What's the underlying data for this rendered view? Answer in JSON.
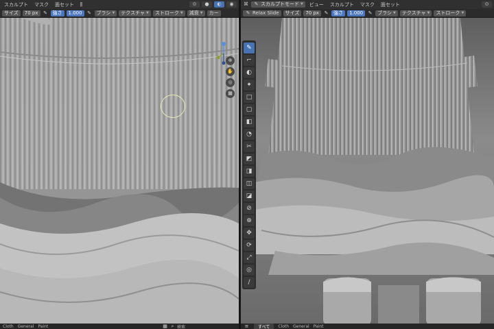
{
  "left": {
    "header_top": {
      "items": [
        "スカルプト",
        "マスク",
        "面セット"
      ],
      "mode_icons": [
        "ǁ",
        "範囲"
      ]
    },
    "header_tool": {
      "size_label": "サイズ",
      "size_value": "70 px",
      "strength_label": "強さ",
      "strength_value": "1.000",
      "brush_label": "ブラシ",
      "texture_label": "テクスチャ",
      "stroke_label": "ストローク",
      "falloff_label": "減衰",
      "cursor_label": "カー"
    },
    "footer_tabs": [
      "Cloth",
      "General",
      "Paint"
    ]
  },
  "right": {
    "header_top": {
      "mode": "スカルプトモード",
      "items": [
        "ビュー",
        "スカルプト",
        "マスク",
        "面セット"
      ]
    },
    "header_tool": {
      "brush_name": "Relax Slide",
      "size_label": "サイズ",
      "size_value": "70 px",
      "strength_label": "強さ",
      "strength_value": "1.000",
      "brush_label": "ブラシ",
      "texture_label": "テクスチャ",
      "stroke_label": "ストローク"
    },
    "footer_tabs": [
      "すべて",
      "Cloth",
      "General",
      "Paint"
    ],
    "tools": [
      "✎",
      "⌐",
      "◐",
      "✦",
      "□",
      "▢",
      "◧",
      "◔",
      "✂",
      "◩",
      "◨",
      "◫",
      "◪",
      "⊘",
      "⊕",
      "✥",
      "⟳",
      "⤢",
      "◎",
      "∕"
    ]
  },
  "center_search": {
    "placeholder": "検索"
  },
  "colors": {
    "accent": "#4772b3",
    "header": "#303030",
    "cursor": "#e8e8b0"
  }
}
